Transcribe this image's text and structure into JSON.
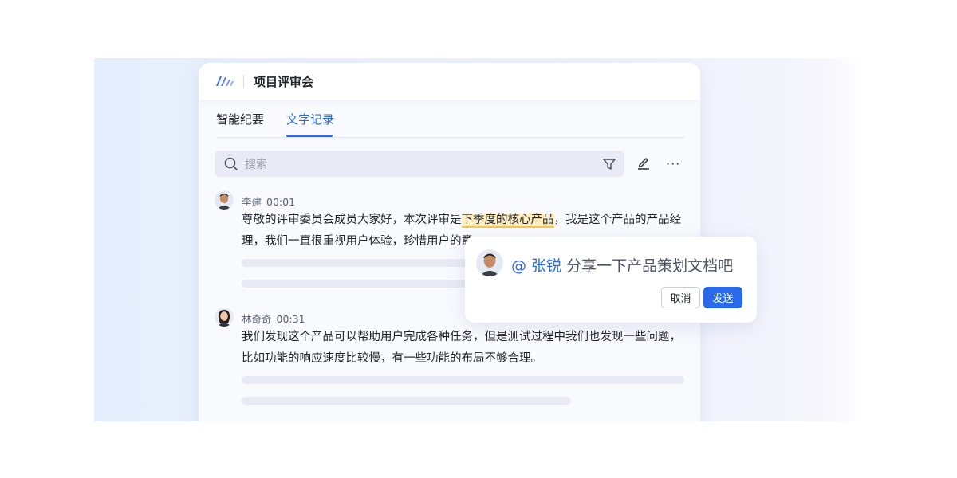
{
  "window": {
    "title": "项目评审会"
  },
  "tabs": [
    {
      "label": "智能纪要",
      "active": false
    },
    {
      "label": "文字记录",
      "active": true
    }
  ],
  "search": {
    "placeholder": "搜索"
  },
  "icons": {
    "logo": "app-logo",
    "search": "search-icon",
    "filter": "filter-icon",
    "edit": "edit-icon",
    "more": "more-icon"
  },
  "more_glyph": "···",
  "transcript": [
    {
      "speaker": "李建",
      "time": "00:01",
      "text_before": "尊敬的评审委员会成员大家好，本次评审是",
      "highlight": "下季度的核心产品",
      "text_after": "，我是这个产品的产品经理，我们一直很重视用户体验，珍惜用户的意"
    },
    {
      "speaker": "林奇奇",
      "time": "00:31",
      "text": "我们发现这个产品可以帮助用户完成各种任务，但是测试过程中我们也发现一些问题，比如功能的响应速度比较慢，有一些功能的布局不够合理。"
    }
  ],
  "popup": {
    "mention": "@ 张锐",
    "message": " 分享一下产品策划文档吧",
    "cancel_label": "取消",
    "send_label": "发送"
  },
  "colors": {
    "accent": "#2a6ae8",
    "highlight_bg": "#fdedc1",
    "highlight_underline": "#f3c84a"
  }
}
